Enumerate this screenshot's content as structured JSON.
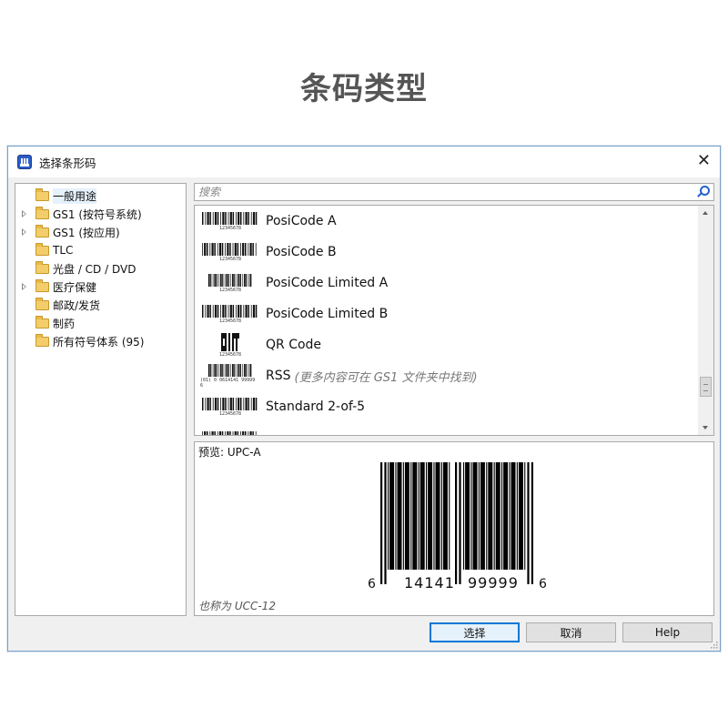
{
  "page_title": "条码类型",
  "dialog": {
    "title": "选择条形码",
    "close_glyph": "✕"
  },
  "tree": {
    "items": [
      {
        "label": "一般用途",
        "expandable": false,
        "selected": true
      },
      {
        "label": "GS1 (按符号系统)",
        "expandable": true,
        "selected": false
      },
      {
        "label": "GS1 (按应用)",
        "expandable": true,
        "selected": false
      },
      {
        "label": "TLC",
        "expandable": false,
        "selected": false
      },
      {
        "label": "光盘 / CD / DVD",
        "expandable": false,
        "selected": false
      },
      {
        "label": "医疗保健",
        "expandable": true,
        "selected": false
      },
      {
        "label": "邮政/发货",
        "expandable": false,
        "selected": false
      },
      {
        "label": "制药",
        "expandable": false,
        "selected": false
      },
      {
        "label": "所有符号体系 (95)",
        "expandable": false,
        "selected": false
      }
    ]
  },
  "search": {
    "placeholder": "搜索"
  },
  "list": {
    "items": [
      {
        "name": "PosiCode A",
        "note": "",
        "thumb": "linear",
        "digits": "12345678"
      },
      {
        "name": "PosiCode B",
        "note": "",
        "thumb": "linear",
        "digits": "12345678"
      },
      {
        "name": "PosiCode Limited A",
        "note": "",
        "thumb": "linear-tall",
        "digits": "12345678"
      },
      {
        "name": "PosiCode Limited B",
        "note": "",
        "thumb": "linear",
        "digits": "12345678"
      },
      {
        "name": "QR Code",
        "note": "",
        "thumb": "qr",
        "digits": "12345678"
      },
      {
        "name": "RSS",
        "note": "(更多内容可在 GS1 文件夹中找到)",
        "thumb": "rss",
        "digits": "(01) 0 0614141 99999 6"
      },
      {
        "name": "Standard 2-of-5",
        "note": "",
        "thumb": "linear",
        "digits": "12345678"
      },
      {
        "name": "",
        "note": "",
        "thumb": "linear",
        "digits": ""
      }
    ]
  },
  "preview": {
    "label": "预览: UPC-A",
    "note": "也称为 UCC-12",
    "human_readable": [
      "6",
      "14141",
      "99999",
      "6"
    ]
  },
  "buttons": {
    "select": "选择",
    "cancel": "取消",
    "help": "Help"
  }
}
